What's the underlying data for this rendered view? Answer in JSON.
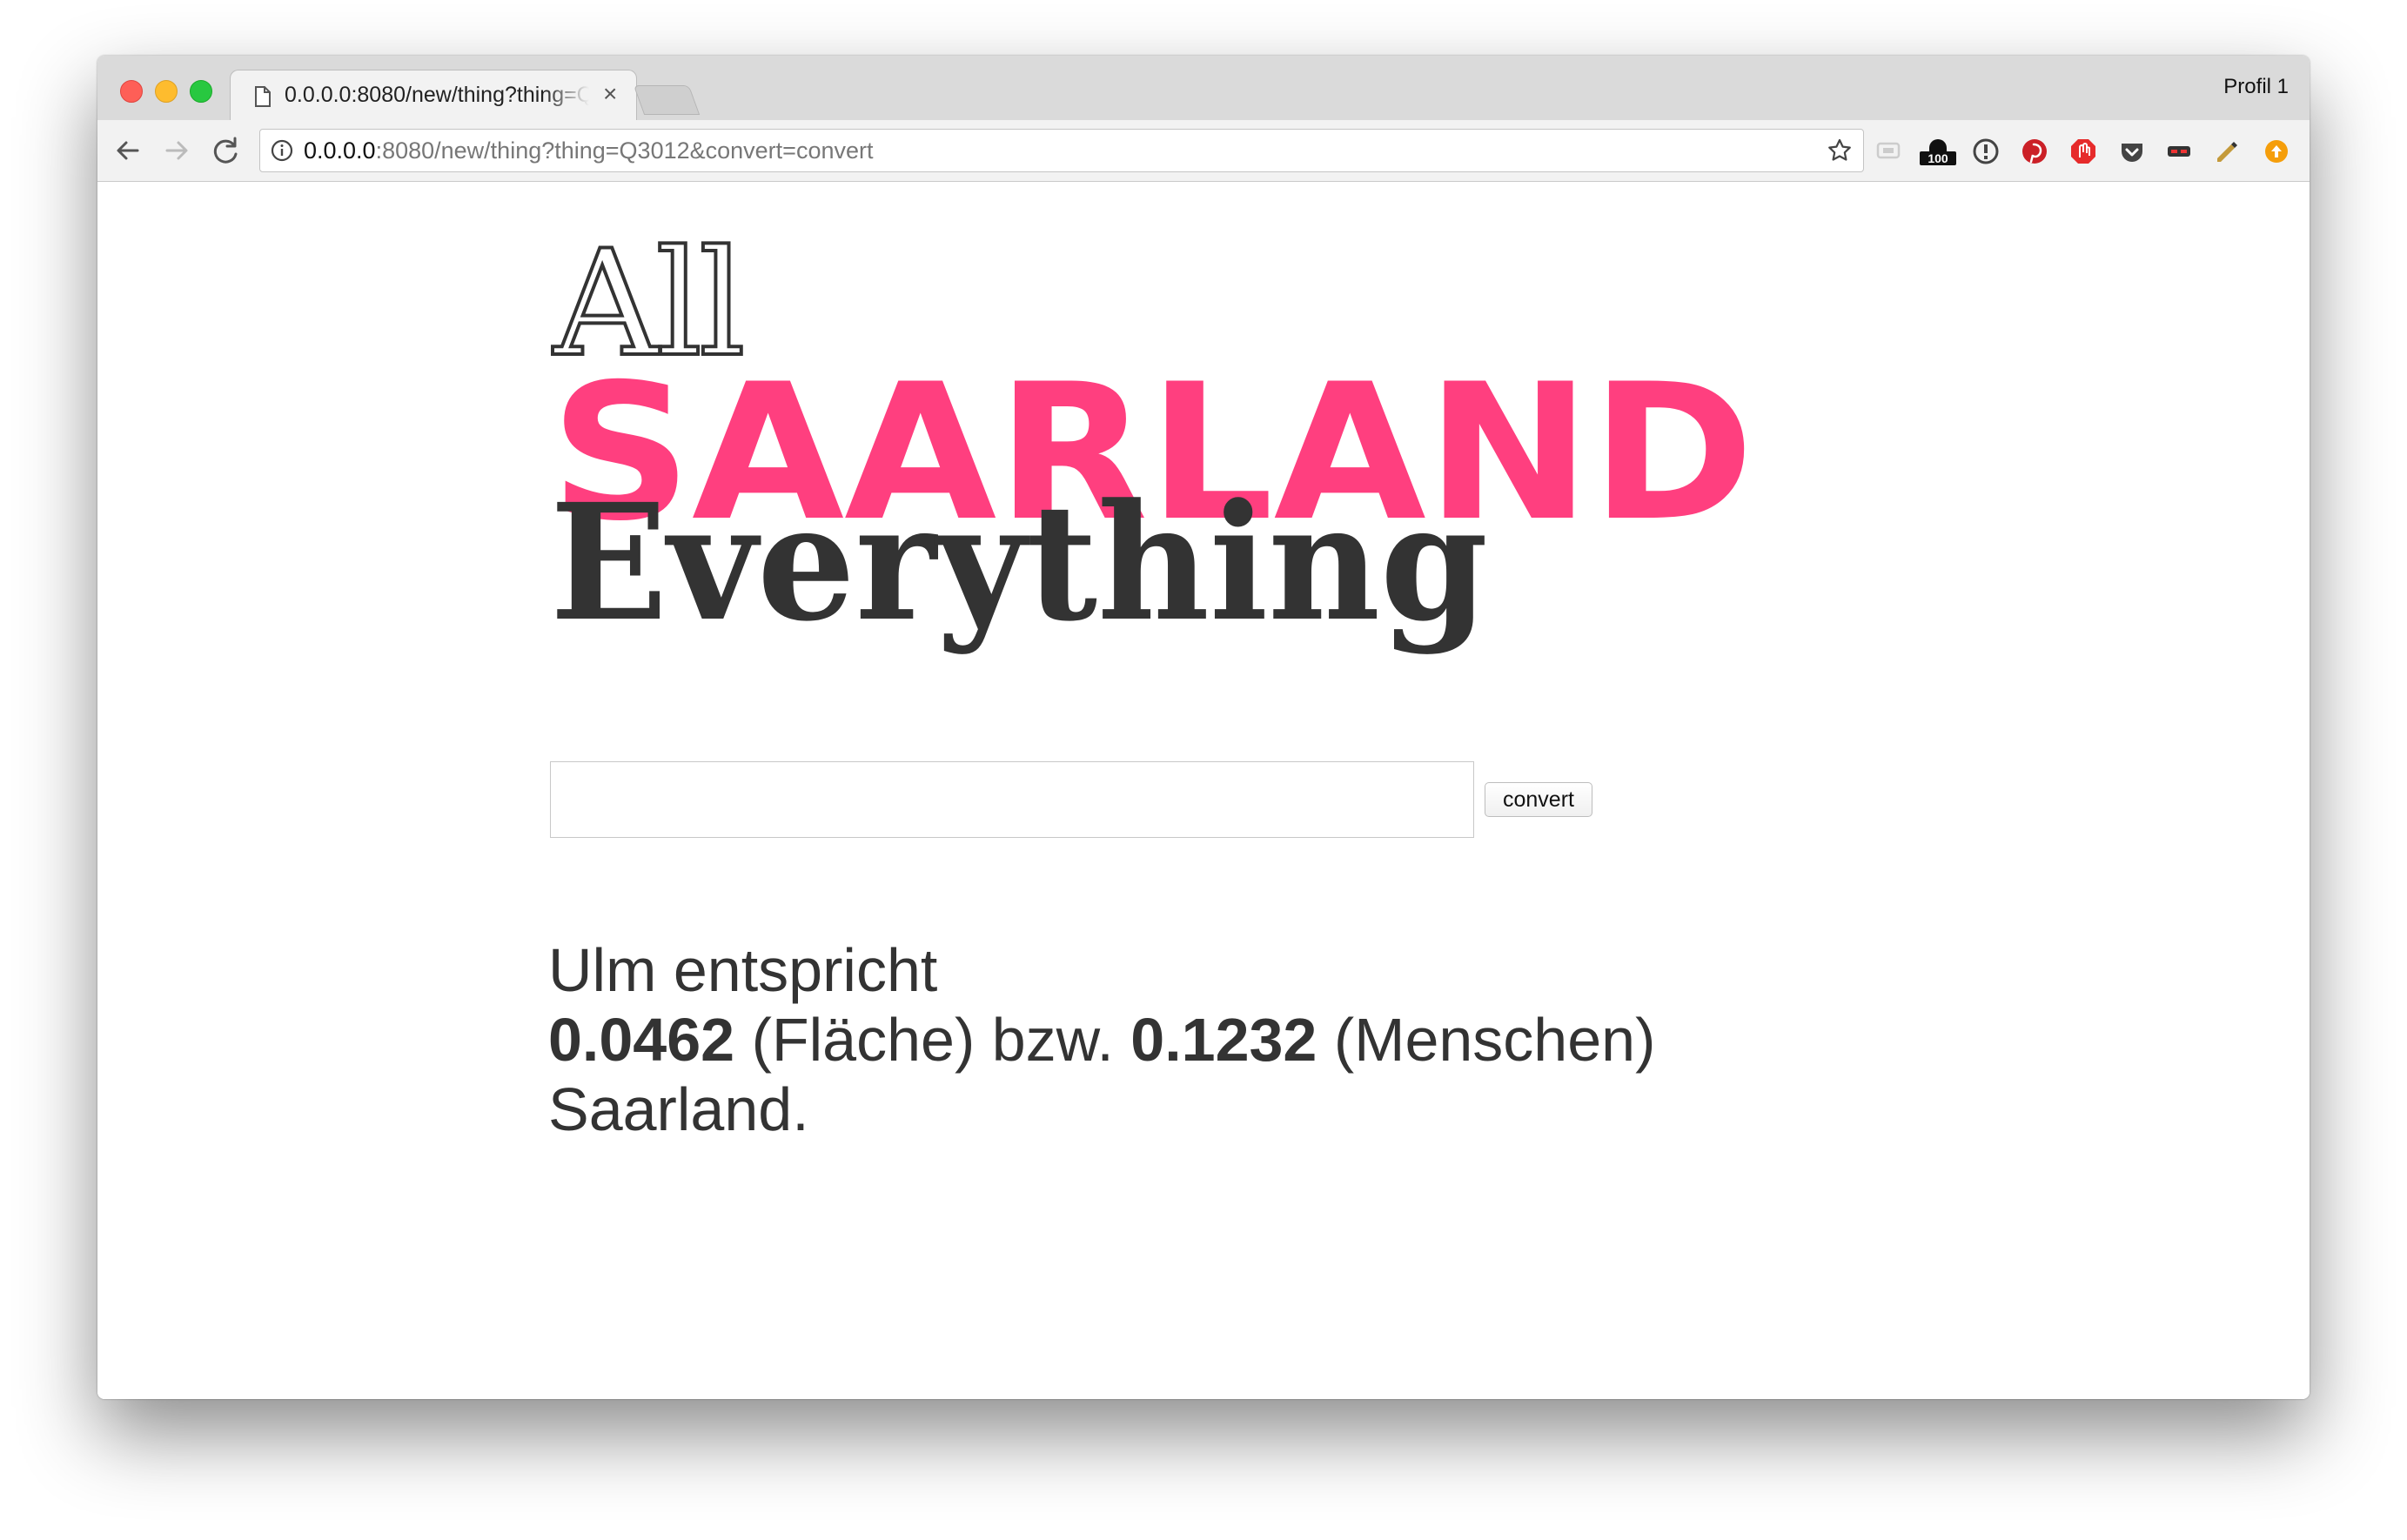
{
  "browser": {
    "tab_title": "0.0.0.0:8080/new/thing?thing=Q3012&convert=convert",
    "tab_close": "×",
    "profile_name": "Profil 1",
    "url_host": "0.0.0.0",
    "url_rest": ":8080/new/thing?thing=Q3012&convert=convert",
    "extension_badge": "100",
    "icons": [
      "back-arrow-icon",
      "forward-arrow-icon",
      "reload-icon",
      "info-icon",
      "bookmark-star-icon"
    ]
  },
  "logo": {
    "line1": "All",
    "line2": "SAARLAND",
    "line3": "Everything",
    "accent_color": "#ff3f7f",
    "text_color": "#333333"
  },
  "form": {
    "input_value": "",
    "convert_label": "convert"
  },
  "result": {
    "subject": "Ulm entspricht",
    "area_value": "0.0462",
    "area_label": "(Fläche) bzw.",
    "people_value": "0.1232",
    "people_label": "(Menschen)",
    "ending": "Saarland."
  }
}
